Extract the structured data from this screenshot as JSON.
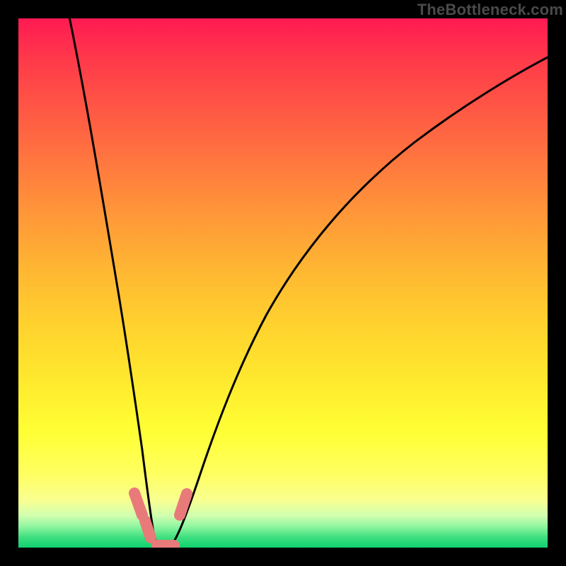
{
  "watermark": "TheBottleneck.com",
  "colors": {
    "gradient_top": "#ff1a52",
    "gradient_mid": "#ffd22e",
    "gradient_bottom": "#10d070",
    "curve": "#000000",
    "marker": "#e97a7a",
    "frame": "#000000"
  },
  "chart_data": {
    "type": "line",
    "title": "",
    "xlabel": "",
    "ylabel": "",
    "xlim": [
      0,
      100
    ],
    "ylim": [
      0,
      100
    ],
    "annotations": [
      "TheBottleneck.com"
    ],
    "legend": [],
    "grid": false,
    "series": [
      {
        "name": "bottleneck-curve",
        "x": [
          0,
          4,
          8,
          12,
          16,
          18,
          20,
          21,
          22,
          23,
          24,
          25,
          26,
          27,
          28,
          29,
          30,
          32,
          36,
          40,
          46,
          54,
          64,
          76,
          90,
          100
        ],
        "values": [
          106,
          96,
          86,
          74,
          60,
          50,
          40,
          32,
          24,
          16,
          10,
          4,
          0,
          -1,
          -1,
          0,
          4,
          12,
          26,
          38,
          50,
          60,
          69,
          76,
          82,
          86
        ]
      }
    ],
    "markers": [
      {
        "name": "left-upper",
        "x": 21.0,
        "y": 8
      },
      {
        "name": "left-lower",
        "x": 23.0,
        "y": 3
      },
      {
        "name": "valley",
        "x": 27.0,
        "y": 0
      },
      {
        "name": "right-upper",
        "x": 31.0,
        "y": 8
      }
    ],
    "notes": "y=0 is the green bottom (best), y=100 is the red top (worst). Values below 0 indicate flat bottom of the notch; values above 100 indicate the curve starts above the visible frame."
  }
}
